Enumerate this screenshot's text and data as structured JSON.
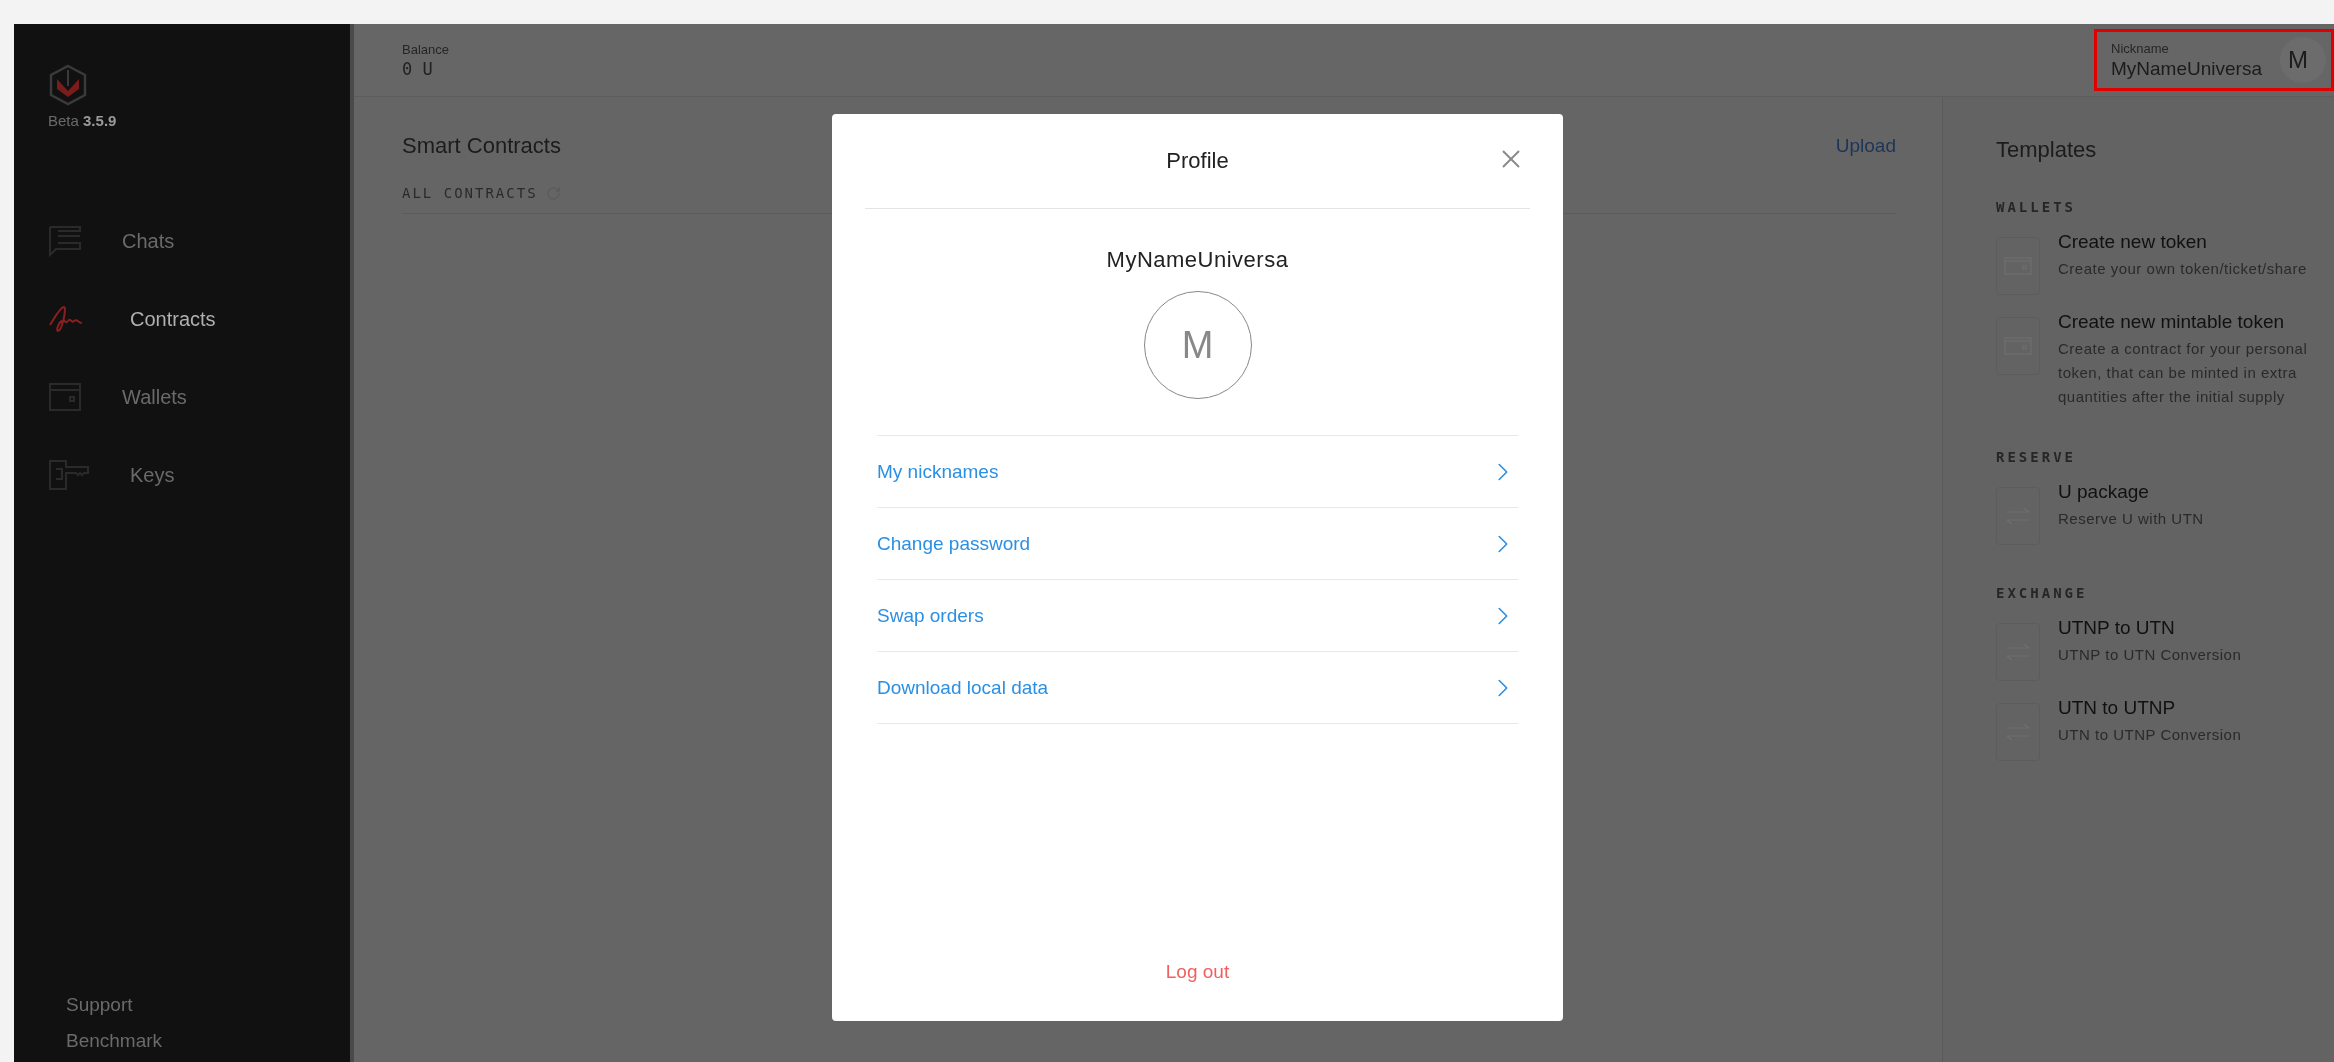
{
  "sidebar": {
    "version_label": "Beta",
    "version": "3.5.9",
    "items": [
      {
        "label": "Chats",
        "kind": "chat",
        "selected": false
      },
      {
        "label": "Contracts",
        "kind": "signature",
        "selected": true
      },
      {
        "label": "Wallets",
        "kind": "wallet",
        "selected": false
      },
      {
        "label": "Keys",
        "kind": "key",
        "selected": false
      }
    ],
    "footer_links": [
      "Support",
      "Benchmark"
    ]
  },
  "top_bar": {
    "balance_label": "Balance",
    "balance": "0 U",
    "nickname_label": "Nickname",
    "nickname": "MyNameUniversa",
    "avatar_letter": "M"
  },
  "contracts": {
    "title": "Smart Contracts",
    "upload": "Upload",
    "tabs": [
      {
        "label": "ALL CONTRACTS",
        "selected": true
      }
    ]
  },
  "templates": {
    "title": "Templates",
    "sections": [
      {
        "heading": "WALLETS",
        "items": [
          {
            "kind": "wallet",
            "title": "Create new token",
            "description": "Create your own token/ticket/share"
          },
          {
            "kind": "wallet",
            "title": "Create new mintable token",
            "description": "Create a contract for your personal token, that can be minted in extra quantities after the initial supply"
          }
        ]
      },
      {
        "heading": "RESERVE",
        "items": [
          {
            "kind": "exchange",
            "title": "U package",
            "description": "Reserve U with UTN"
          }
        ]
      },
      {
        "heading": "EXCHANGE",
        "items": [
          {
            "kind": "exchange",
            "title": "UTNP to UTN",
            "description": "UTNP to UTN Conversion"
          },
          {
            "kind": "exchange",
            "title": "UTN to UTNP",
            "description": "UTN to UTNP Conversion"
          }
        ]
      }
    ]
  },
  "profile_dialog": {
    "title": "Profile",
    "username": "MyNameUniversa",
    "avatar_letter": "M",
    "menu": [
      "My nicknames",
      "Change password",
      "Swap orders",
      "Download local data"
    ],
    "logout": "Log out"
  }
}
